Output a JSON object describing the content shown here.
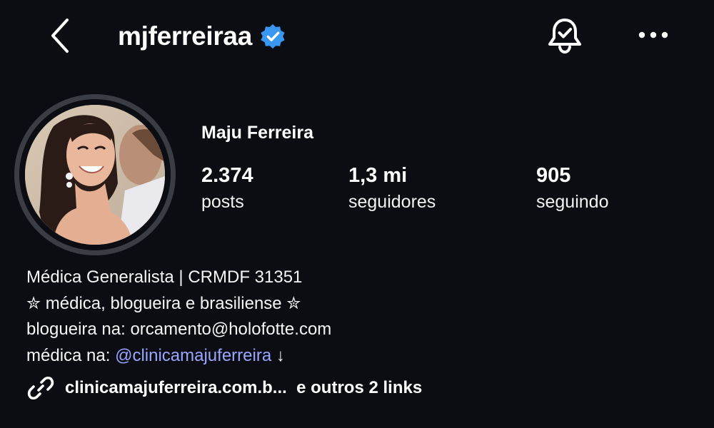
{
  "header": {
    "back_icon": "chevron-left-icon",
    "username": "mjferreiraa",
    "verified_icon": "verified-badge-icon",
    "verified_color": "#3897f0",
    "bell_icon": "bell-check-icon",
    "more_icon": "more-horizontal-icon"
  },
  "profile": {
    "display_name": "Maju Ferreira",
    "avatar": "profile-photo"
  },
  "stats": {
    "posts": {
      "value": "2.374",
      "label": "posts"
    },
    "followers": {
      "value": "1,3 mi",
      "label": "seguidores"
    },
    "following": {
      "value": "905",
      "label": "seguindo"
    }
  },
  "bio": {
    "line1": "Médica Generalista | CRMDF 31351",
    "line2": "✮ médica, blogueira e brasiliense ✮",
    "line3": "blogueira na: orcamento@holofotte.com",
    "line4_prefix": "médica na: ",
    "line4_mention": "@clinicamajuferreira",
    "line4_suffix": " ↓",
    "mention_color": "#9aa6ff"
  },
  "links": {
    "icon": "link-icon",
    "text": "clinicamajuferreira.com.b...  e outros 2 links"
  }
}
